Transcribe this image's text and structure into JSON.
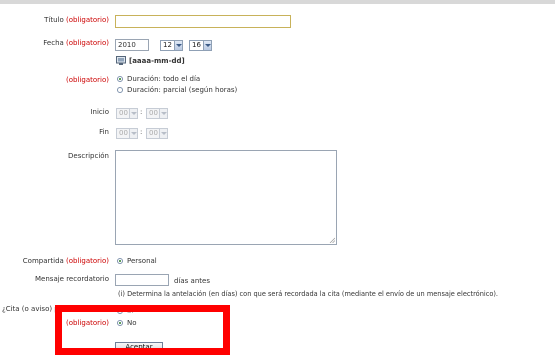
{
  "form": {
    "titulo": {
      "label": "Título",
      "req": "(obligatorio)",
      "value": ""
    },
    "fecha": {
      "label": "Fecha",
      "req": "(obligatorio)",
      "year": "2010",
      "month": "12",
      "day": "16",
      "format_hint": "[aaaa-mm-dd]"
    },
    "duracion": {
      "req": "(obligatorio)",
      "options": [
        "Duración: todo el día",
        "Duración: parcial (según horas)"
      ],
      "selected": 0
    },
    "inicio": {
      "label": "Inicio",
      "hour": "00",
      "sep": ":",
      "min": "00"
    },
    "fin": {
      "label": "Fin",
      "hour": "00",
      "sep": ":",
      "min": "00"
    },
    "descripcion": {
      "label": "Descripción",
      "value": ""
    },
    "compartida": {
      "label": "Compartida",
      "req": "(obligatorio)",
      "option": "Personal"
    },
    "recordatorio": {
      "label": "Mensaje recordatorio",
      "value": "",
      "suffix": "días antes",
      "help": "(i) Determina la antelación (en días) con que será recordada la cita (mediante el envío de un mensaje electrónico)."
    },
    "periodica": {
      "label": "¿Cita (o aviso) periódica?",
      "req": "(obligatorio)",
      "options": [
        "Sí",
        "No"
      ],
      "selected": 1
    },
    "submit_label": "Aceptar"
  },
  "colors": {
    "required": "#cc0000",
    "highlight": "#ff0000",
    "radio_checked": "#2a7d2a"
  },
  "icons": {
    "calendar": "calendar-icon"
  }
}
